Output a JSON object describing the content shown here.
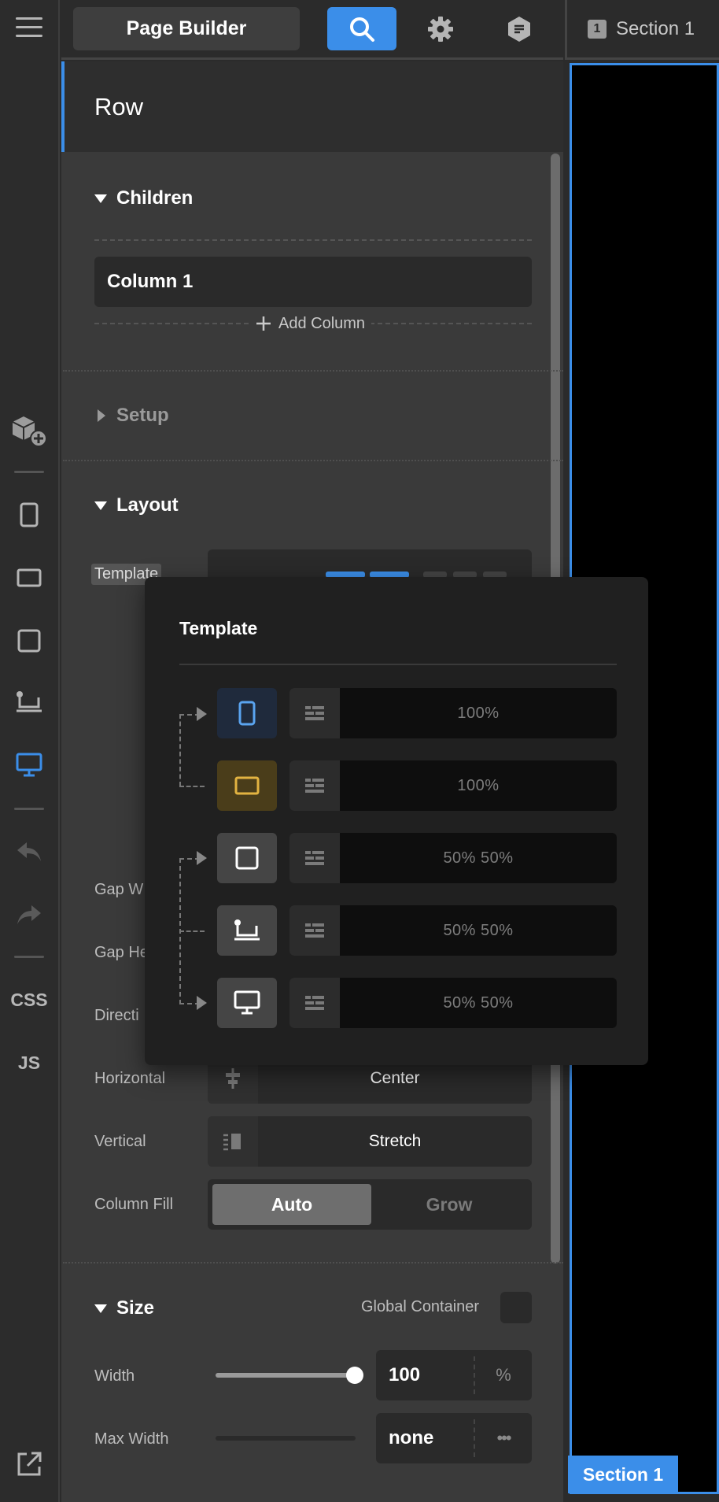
{
  "topbar": {
    "title": "Page Builder",
    "section_tab_number": "1",
    "section_tab_label": "Section 1"
  },
  "rail": {
    "css_label": "CSS",
    "js_label": "JS"
  },
  "panel": {
    "heading": "Row",
    "children": {
      "title": "Children",
      "items": [
        "Column 1"
      ],
      "add_label": "Add Column"
    },
    "setup": {
      "title": "Setup"
    },
    "layout": {
      "title": "Layout",
      "template_label": "Template",
      "gap_width_label": "Gap W",
      "gap_height_label": "Gap He",
      "direction_label": "Directi",
      "horizontal_label": "Horizontal",
      "horizontal_value": "Center",
      "vertical_label": "Vertical",
      "vertical_value": "Stretch",
      "column_fill_label": "Column Fill",
      "column_fill_options": [
        "Auto",
        "Grow"
      ],
      "column_fill_selected": "Auto"
    },
    "size": {
      "title": "Size",
      "global_container_label": "Global Container",
      "width_label": "Width",
      "width_value": "100",
      "width_unit": "%",
      "width_slider_fraction": 1.0,
      "max_width_label": "Max Width",
      "max_width_value": "none",
      "max_width_unit": "•••"
    }
  },
  "popup": {
    "title": "Template",
    "rows": [
      {
        "device": "phone",
        "value": "100%"
      },
      {
        "device": "tablet",
        "value": "100%"
      },
      {
        "device": "tablet-portrait",
        "value": "50% 50%"
      },
      {
        "device": "laptop",
        "value": "50% 50%"
      },
      {
        "device": "desktop",
        "value": "50% 50%"
      }
    ]
  },
  "preview": {
    "section_label": "Section 1"
  },
  "colors": {
    "accent": "#3b8ee9",
    "tablet_highlight": "#e2b341",
    "panel_bg": "#3a3a3a",
    "canvas_bg": "#000000"
  }
}
